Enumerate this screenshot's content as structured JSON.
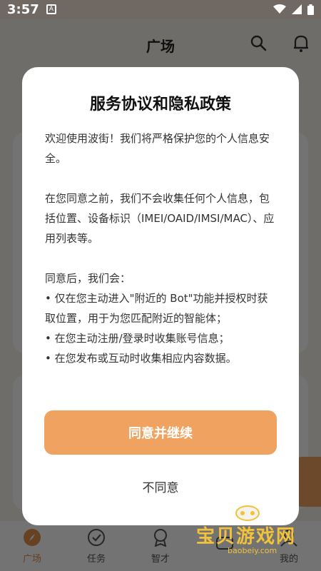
{
  "status": {
    "time": "3:57"
  },
  "appbar": {
    "title": "广场"
  },
  "dialog": {
    "title": "服务协议和隐私政策",
    "paragraphs": [
      "欢迎使用波街！我们将严格保护您的个人信息安全。",
      "在您同意之前，我们不会收集任何个人信息，包括位置、设备标识（IMEI/OAID/IMSI/MAC）、应用列表等。"
    ],
    "after_heading": "同意后，我们会：",
    "bullets": [
      "仅在您主动进入\"附近的 Bot\"功能并授权时获取位置，用于为您匹配附近的智能体；",
      "在您主动注册/登录时收集账号信息；",
      "在您发布或互动时收集相应内容数据。"
    ],
    "agree_label": "同意并继续",
    "disagree_label": "不同意"
  },
  "nav": {
    "items": [
      {
        "label": "广场",
        "icon": "compass-icon"
      },
      {
        "label": "任务",
        "icon": "check-circle-icon"
      },
      {
        "label": "智才",
        "icon": "badge-icon"
      },
      {
        "label": "",
        "icon": "chat-icon"
      },
      {
        "label": "我的",
        "icon": "user-icon"
      }
    ]
  },
  "watermark": {
    "text": "宝贝游戏网",
    "url": "baobeiy.com"
  },
  "colors": {
    "accent": "#f0a361",
    "overlay": "#000000",
    "watermark": "#f2c23a"
  }
}
